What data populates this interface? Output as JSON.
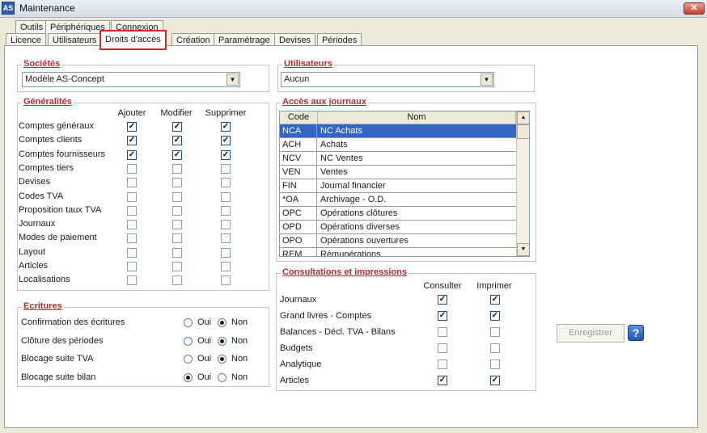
{
  "window": {
    "title": "Maintenance",
    "close": "✕",
    "app_icon": "AS"
  },
  "tabs_top": [
    "Outils",
    "Périphériques",
    "Connexion"
  ],
  "tabs_bottom": [
    "Licence",
    "Utilisateurs",
    "Droits d'accès",
    "Création",
    "Paramétrage",
    "Devises",
    "Périodes"
  ],
  "active_tab": "Droits d'accès",
  "societes": {
    "title": "Sociétés",
    "value": "Modèle AS-Concept"
  },
  "utilisateurs": {
    "title": "Utilisateurs",
    "value": "Aucun"
  },
  "generalites": {
    "title": "Généralités",
    "columns": [
      "Ajouter",
      "Modifier",
      "Supprimer"
    ],
    "rows": [
      {
        "label": "Comptes généraux",
        "checks": [
          true,
          true,
          true
        ]
      },
      {
        "label": "Comptes clients",
        "checks": [
          true,
          true,
          true
        ]
      },
      {
        "label": "Comptes fournisseurs",
        "checks": [
          true,
          true,
          true
        ]
      },
      {
        "label": "Comptes tiers",
        "checks": [
          false,
          false,
          false
        ]
      },
      {
        "label": "Devises",
        "checks": [
          false,
          false,
          false
        ]
      },
      {
        "label": "Codes TVA",
        "checks": [
          false,
          false,
          false
        ]
      },
      {
        "label": "Proposition taux TVA",
        "checks": [
          false,
          false,
          false
        ]
      },
      {
        "label": "Journaux",
        "checks": [
          false,
          false,
          false
        ]
      },
      {
        "label": "Modes de paiement",
        "checks": [
          false,
          false,
          false
        ]
      },
      {
        "label": "Layout",
        "checks": [
          false,
          false,
          false
        ]
      },
      {
        "label": "Articles",
        "checks": [
          false,
          false,
          false
        ]
      },
      {
        "label": "Localisations",
        "checks": [
          false,
          false,
          false
        ]
      }
    ]
  },
  "ecritures": {
    "title": "Ecritures",
    "oui": "Oui",
    "non": "Non",
    "rows": [
      {
        "label": "Confirmation des écritures",
        "value": "Non"
      },
      {
        "label": "Clôture des périodes",
        "value": "Non"
      },
      {
        "label": "Blocage suite TVA",
        "value": "Non"
      },
      {
        "label": "Blocage suite bilan",
        "value": "Oui"
      }
    ]
  },
  "journaux": {
    "title": "Accès aux journaux",
    "headers": [
      "Code",
      "Nom"
    ],
    "rows": [
      {
        "code": "NCA",
        "nom": "NC Achats",
        "selected": true
      },
      {
        "code": "ACH",
        "nom": "Achats"
      },
      {
        "code": "NCV",
        "nom": "NC Ventes"
      },
      {
        "code": "VEN",
        "nom": "Ventes"
      },
      {
        "code": "FIN",
        "nom": "Journal financier"
      },
      {
        "code": "*OA",
        "nom": "Archivage - O.D."
      },
      {
        "code": "OPC",
        "nom": "Opérations clôtures"
      },
      {
        "code": "OPD",
        "nom": "Opérations diverses"
      },
      {
        "code": "OPO",
        "nom": "Opérations ouvertures"
      },
      {
        "code": "REM",
        "nom": "Rémunérations"
      }
    ]
  },
  "consultations": {
    "title": "Consultations et impressions",
    "columns": [
      "Consulter",
      "Imprimer"
    ],
    "rows": [
      {
        "label": "Journaux",
        "checks": [
          true,
          true
        ]
      },
      {
        "label": "Grand livres - Comptes",
        "checks": [
          true,
          true
        ]
      },
      {
        "label": "Balances - Décl. TVA - Bilans",
        "checks": [
          false,
          false
        ]
      },
      {
        "label": "Budgets",
        "checks": [
          false,
          false
        ]
      },
      {
        "label": "Analytique",
        "checks": [
          false,
          false
        ]
      },
      {
        "label": "Articles",
        "checks": [
          true,
          true
        ]
      }
    ]
  },
  "buttons": {
    "save": "Enregistrer",
    "help": "?"
  },
  "colors": {
    "accent_red": "#c0282d",
    "selection": "#3166c4"
  }
}
